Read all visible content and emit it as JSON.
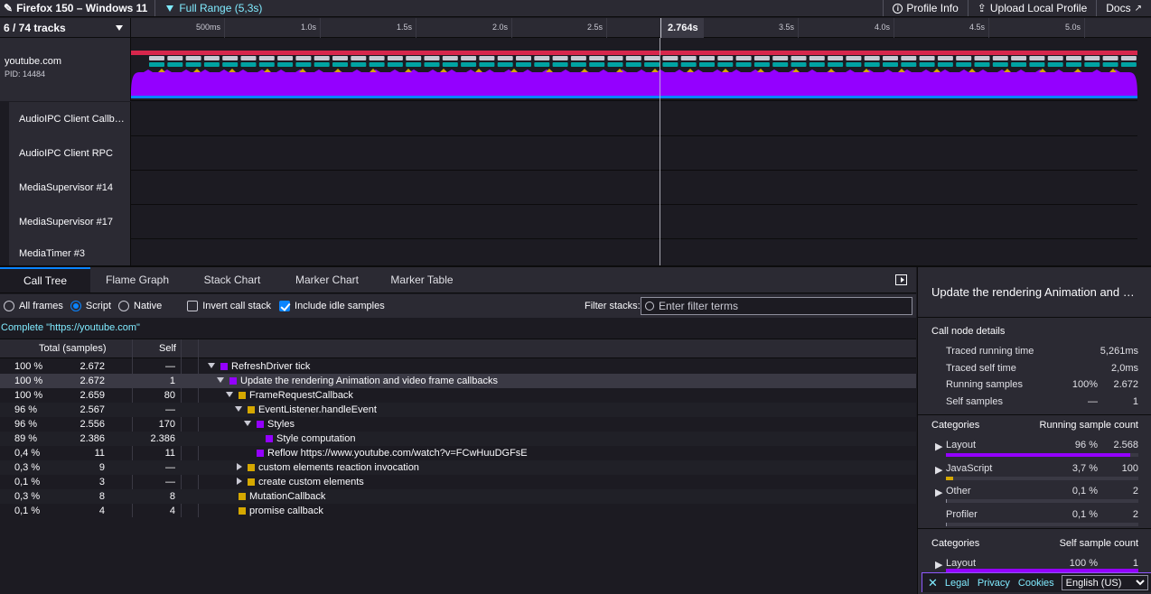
{
  "topbar": {
    "profile_name": "Firefox 150 – Windows 11",
    "range": "Full Range (5,3s)",
    "profile_info": "Profile Info",
    "upload": "Upload Local Profile",
    "docs": "Docs"
  },
  "timeline": {
    "track_count": "6 / 74 tracks",
    "ticks": [
      "500ms",
      "1.0s",
      "1.5s",
      "2.0s",
      "2.5s",
      "3.0s",
      "3.5s",
      "4.0s",
      "4.5s",
      "5.0s"
    ],
    "cursor_time": "2.764s",
    "main_track": {
      "name": "youtube.com",
      "pid": "PID: 14484"
    },
    "tracks": [
      "AudioIPC Client Callb…",
      "AudioIPC Client RPC",
      "MediaSupervisor #14",
      "MediaSupervisor #17",
      "MediaTimer #3"
    ]
  },
  "tabs": [
    "Call Tree",
    "Flame Graph",
    "Stack Chart",
    "Marker Chart",
    "Marker Table"
  ],
  "settings": {
    "all_frames": "All frames",
    "script": "Script",
    "native": "Native",
    "invert": "Invert call stack",
    "idle": "Include idle samples",
    "filter_label": "Filter stacks:",
    "filter_placeholder": "Enter filter terms"
  },
  "breadcrumb": "Complete \"https://youtube.com\"",
  "table": {
    "headers": {
      "total": "Total (samples)",
      "self": "Self"
    },
    "rows": [
      {
        "pct": "100 %",
        "total": "2.672",
        "self": "—",
        "name": "RefreshDriver tick",
        "color": "#9400ff",
        "twisty": "open",
        "depth": 0
      },
      {
        "pct": "100 %",
        "total": "2.672",
        "self": "1",
        "name": "Update the rendering Animation and video frame callbacks",
        "color": "#9400ff",
        "twisty": "open",
        "depth": 1
      },
      {
        "pct": "100 %",
        "total": "2.659",
        "self": "80",
        "name": "FrameRequestCallback",
        "color": "#d5a800",
        "twisty": "open",
        "depth": 2
      },
      {
        "pct": "96 %",
        "total": "2.567",
        "self": "—",
        "name": "EventListener.handleEvent",
        "color": "#d5a800",
        "twisty": "open",
        "depth": 3
      },
      {
        "pct": "96 %",
        "total": "2.556",
        "self": "170",
        "name": "Styles",
        "color": "#9400ff",
        "twisty": "open",
        "depth": 4
      },
      {
        "pct": "89 %",
        "total": "2.386",
        "self": "2.386",
        "name": "Style computation",
        "color": "#9400ff",
        "twisty": "none",
        "depth": 5
      },
      {
        "pct": "0,4 %",
        "total": "11",
        "self": "11",
        "name": "Reflow https://www.youtube.com/watch?v=FCwHuuDGFsE",
        "color": "#9400ff",
        "twisty": "none",
        "depth": 4
      },
      {
        "pct": "0,3 %",
        "total": "9",
        "self": "—",
        "name": "custom elements reaction invocation",
        "color": "#d5a800",
        "twisty": "closed",
        "depth": 3
      },
      {
        "pct": "0,1 %",
        "total": "3",
        "self": "—",
        "name": "create custom elements",
        "color": "#d5a800",
        "twisty": "closed",
        "depth": 3
      },
      {
        "pct": "0,3 %",
        "total": "8",
        "self": "8",
        "name": "MutationCallback",
        "color": "#d5a800",
        "twisty": "none",
        "depth": 2
      },
      {
        "pct": "0,1 %",
        "total": "4",
        "self": "4",
        "name": "promise callback",
        "color": "#d5a800",
        "twisty": "none",
        "depth": 2
      }
    ]
  },
  "sidebar": {
    "title": "Update the rendering Animation and …",
    "details_heading": "Call node details",
    "details": [
      {
        "label": "Traced running time",
        "v1": "",
        "v2": "5,261ms"
      },
      {
        "label": "Traced self time",
        "v1": "",
        "v2": "2,0ms"
      },
      {
        "label": "Running samples",
        "v1": "100%",
        "v2": "2.672"
      },
      {
        "label": "Self samples",
        "v1": "—",
        "v2": "1"
      }
    ],
    "cat_heading": "Categories",
    "cat_sub": "Running sample count",
    "categories": [
      {
        "name": "Layout",
        "pct": "96 %",
        "count": "2.568",
        "color": "#9400ff",
        "fill": 0.96,
        "expandable": true
      },
      {
        "name": "JavaScript",
        "pct": "3,7 %",
        "count": "100",
        "color": "#d5a800",
        "fill": 0.037,
        "expandable": true
      },
      {
        "name": "Other",
        "pct": "0,1 %",
        "count": "2",
        "color": "#8f8f9d",
        "fill": 0.001,
        "expandable": true
      },
      {
        "name": "Profiler",
        "pct": "0,1 %",
        "count": "2",
        "color": "#8f8f9d",
        "fill": 0.001,
        "expandable": false
      }
    ],
    "self_heading": "Categories",
    "self_sub": "Self sample count",
    "self_categories": [
      {
        "name": "Layout",
        "pct": "100 %",
        "count": "1"
      }
    ]
  },
  "footer": {
    "legal": "Legal",
    "privacy": "Privacy",
    "cookies": "Cookies",
    "language": "English (US)"
  },
  "colors": {
    "accent": "#0a84ff",
    "layout": "#9400ff",
    "javascript": "#d5a800"
  }
}
